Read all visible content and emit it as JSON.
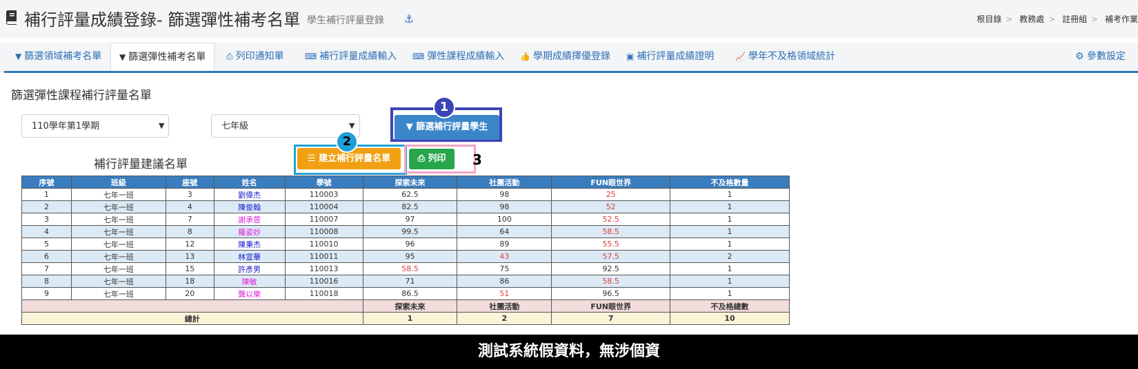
{
  "header": {
    "title": "補行評量成績登錄- 篩選彈性補考名單",
    "subtitle": "學生補行評量登錄",
    "breadcrumb": [
      "根目錄",
      "教務處",
      "註冊組",
      "補考作業"
    ]
  },
  "tabs": [
    {
      "label": "篩選領域補考名單",
      "icon": "filter-icon"
    },
    {
      "label": "篩選彈性補考名單",
      "icon": "filter-icon",
      "active": true
    },
    {
      "label": "列印通知單",
      "icon": "print-icon"
    },
    {
      "label": "補行評量成績輸入",
      "icon": "keyboard-icon"
    },
    {
      "label": "彈性課程成績輸入",
      "icon": "keyboard-icon"
    },
    {
      "label": "學期成績擇優登錄",
      "icon": "thumbs-up-icon"
    },
    {
      "label": "補行評量成績證明",
      "icon": "id-card-icon"
    },
    {
      "label": "學年不及格領域統計",
      "icon": "line-chart-icon"
    }
  ],
  "settings_label": "參數設定",
  "panel": {
    "title": "篩選彈性課程補行評量名單",
    "semester_select": "110學年第1學期",
    "grade_select": "七年級",
    "filter_button": "篩選補行評量學生",
    "create_button": "建立補行評量名單",
    "print_button": "列印",
    "suggest_title": "補行評量建議名單",
    "badges": [
      "1",
      "2",
      "3"
    ]
  },
  "table": {
    "headers": [
      "序號",
      "班級",
      "座號",
      "姓名",
      "學號",
      "探索未來",
      "社團活動",
      "FUN眼世界",
      "不及格數量"
    ],
    "rows": [
      [
        "1",
        "七年一班",
        "3",
        "劉偉杰",
        "110003",
        "62.5",
        "98",
        "25",
        "1"
      ],
      [
        "2",
        "七年一班",
        "4",
        "陳俊翰",
        "110004",
        "82.5",
        "98",
        "52",
        "1"
      ],
      [
        "3",
        "七年一班",
        "7",
        "謝承萱",
        "110007",
        "97",
        "100",
        "52.5",
        "1"
      ],
      [
        "4",
        "七年一班",
        "8",
        "羅姿妙",
        "110008",
        "99.5",
        "64",
        "58.5",
        "1"
      ],
      [
        "5",
        "七年一班",
        "12",
        "陳秉杰",
        "110010",
        "96",
        "89",
        "55.5",
        "1"
      ],
      [
        "6",
        "七年一班",
        "13",
        "林宣華",
        "110011",
        "95",
        "43",
        "57.5",
        "2"
      ],
      [
        "7",
        "七年一班",
        "15",
        "許彥男",
        "110013",
        "58.5",
        "75",
        "92.5",
        "1"
      ],
      [
        "8",
        "七年一班",
        "18",
        "陳敏",
        "110016",
        "71",
        "86",
        "58.5",
        "1"
      ],
      [
        "9",
        "七年一班",
        "20",
        "龔以樂",
        "110018",
        "86.5",
        "51",
        "96.5",
        "1"
      ]
    ],
    "summary_headers": [
      "探索未來",
      "社團活動",
      "FUN眼世界",
      "不及格總數"
    ],
    "total_label": "總計",
    "totals": [
      "1",
      "2",
      "7",
      "10"
    ]
  },
  "footer": {
    "notice": "測試系統假資料，無涉個資"
  }
}
